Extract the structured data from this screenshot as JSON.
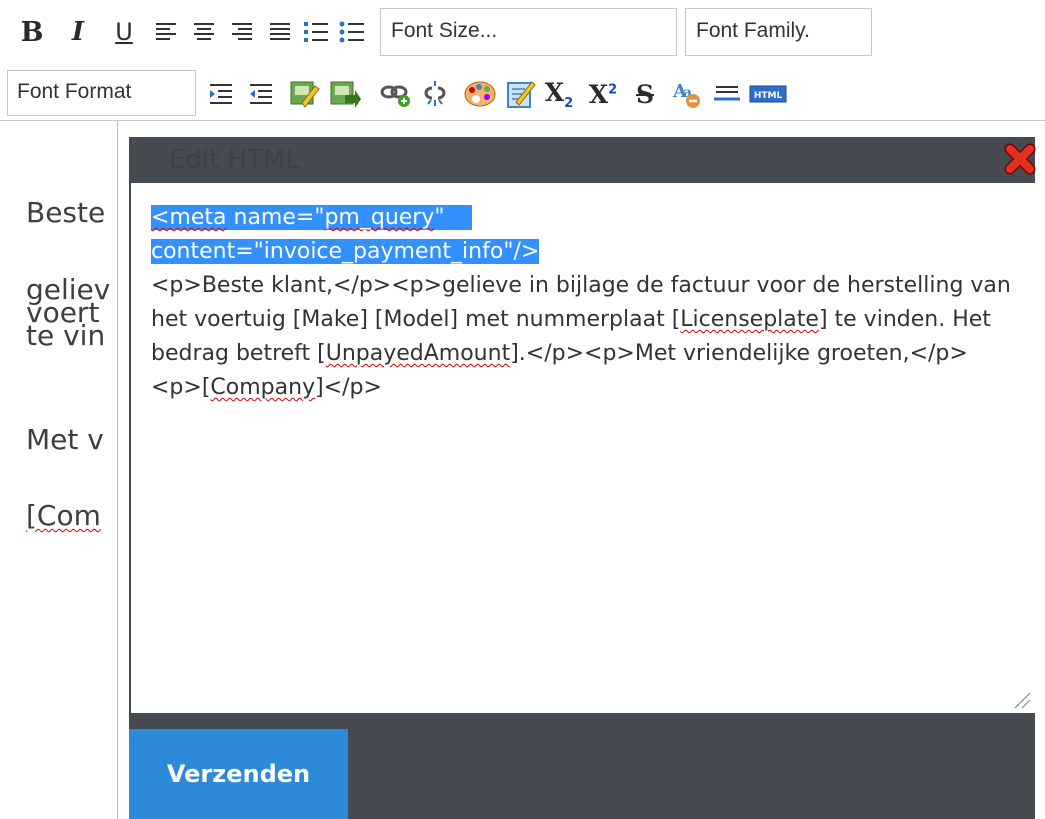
{
  "toolbar": {
    "bold_label": "B",
    "italic_label": "I",
    "underline_label": "U",
    "subscript_label": "X",
    "subscript_mark": "2",
    "superscript_label": "X",
    "superscript_mark": "2",
    "strikethrough_label": "S",
    "font_size_label": "Font Size...",
    "font_family_label": "Font Family.",
    "font_format_label": "Font Format",
    "html_badge": "HTML",
    "icons": [
      "bold-icon",
      "italic-icon",
      "underline-icon",
      "align-left-icon",
      "align-center-icon",
      "align-right-icon",
      "justify-icon",
      "ordered-list-icon",
      "unordered-list-icon",
      "indent-icon",
      "outdent-icon",
      "insert-image-icon",
      "image-arrow-icon",
      "link-icon",
      "unlink-icon",
      "color-palette-icon",
      "edit-note-icon",
      "subscript-icon",
      "superscript-icon",
      "strikethrough-icon",
      "remove-format-icon",
      "horizontal-rule-icon",
      "html-source-icon"
    ]
  },
  "background_editor": {
    "line1": "Beste",
    "line2a": "geliev",
    "line2b": "voert",
    "line2c": "te vin",
    "line3": "Met v",
    "line4": "[Com"
  },
  "dialog": {
    "title": "Edit HTML",
    "content": {
      "selected_line1": "<meta name=\"pm_query\"",
      "selected_line2": "content=\"invoice_payment_info\"/>",
      "body_seg1": "<p>Beste klant,</p><p>gelieve in bijlage de factuur voor de herstelling van het voertuig [Make] [Model] met nummerplaat [",
      "licenseplate_word": "Licenseplate",
      "body_seg2": "] te vinden. Het bedrag betreft [",
      "unpayed_word": "UnpayedAmount",
      "body_seg3": "].</p><p>Met vriendelijke groeten,</p><p>[",
      "company_word": "Company",
      "body_seg4": "]</p>"
    },
    "send_button": "Verzenden"
  },
  "colors": {
    "dialog_header": "#454b50",
    "selection": "#3390ff",
    "send_button": "#2c8ad8",
    "spell_underline": "#d40000"
  }
}
